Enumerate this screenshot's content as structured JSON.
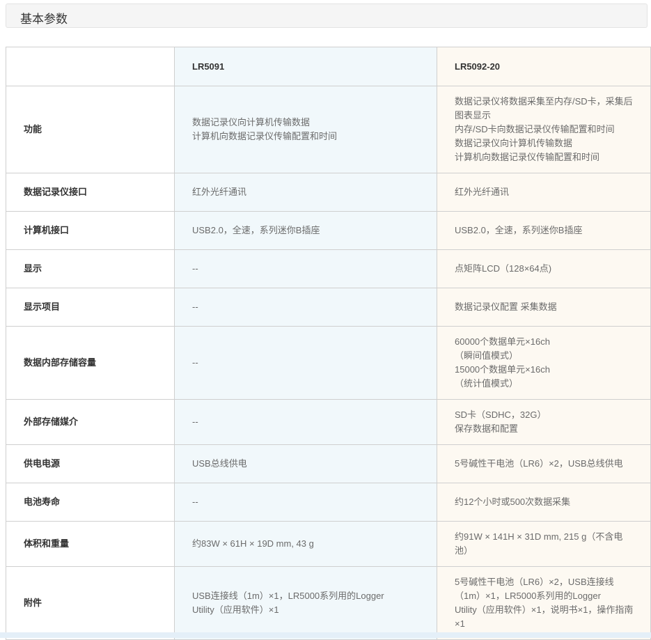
{
  "section": {
    "title": "基本参数"
  },
  "columns": {
    "model_a": "LR5091",
    "model_b": "LR5092-20"
  },
  "rows": [
    {
      "label": "功能",
      "a": [
        "数据记录仪向计算机传输数据",
        "计算机向数据记录仪传输配置和时间"
      ],
      "b": [
        "数据记录仪将数据采集至内存/SD卡，采集后",
        "图表显示",
        "内存/SD卡向数据记录仪传输配置和时间",
        "数据记录仪向计算机传输数据",
        "计算机向数据记录仪传输配置和时间"
      ]
    },
    {
      "label": "数据记录仪接口",
      "a": [
        "红外光纤通讯"
      ],
      "b": [
        "红外光纤通讯"
      ]
    },
    {
      "label": "计算机接口",
      "a": [
        "USB2.0，全速，系列迷你B插座"
      ],
      "b": [
        "USB2.0，全速，系列迷你B插座"
      ]
    },
    {
      "label": "显示",
      "a": [
        "--"
      ],
      "b": [
        "点矩阵LCD（128×64点)"
      ]
    },
    {
      "label": "显示项目",
      "a": [
        "--"
      ],
      "b": [
        "数据记录仪配置 采集数据"
      ]
    },
    {
      "label": "数据内部存储容量",
      "a": [
        "--"
      ],
      "b": [
        "60000个数据单元×16ch",
        "（瞬间值模式）",
        "15000个数据单元×16ch",
        "（统计值模式）"
      ]
    },
    {
      "label": "外部存储媒介",
      "a": [
        "--"
      ],
      "b": [
        "SD卡（SDHC，32G）",
        "保存数据和配置"
      ]
    },
    {
      "label": "供电电源",
      "a": [
        "USB总线供电"
      ],
      "b": [
        "5号碱性干电池（LR6）×2，USB总线供电"
      ]
    },
    {
      "label": "电池寿命",
      "a": [
        "--"
      ],
      "b": [
        "约12个小时或500次数据采集"
      ]
    },
    {
      "label": "体积和重量",
      "a": [
        "约83W × 61H × 19D mm, 43 g"
      ],
      "b": [
        "约91W × 141H × 31D mm, 215 g（不含电",
        "池）"
      ]
    },
    {
      "label": "附件",
      "a": [
        "USB连接线（1m）×1，LR5000系列用的Logger",
        "Utility（应用软件）×1"
      ],
      "b": [
        "5号碱性干电池（LR6）×2，USB连接线",
        "（1m）×1，LR5000系列用的Logger",
        "Utility（应用软件）×1，说明书×1，操作指南",
        "×1"
      ]
    }
  ],
  "colors": {
    "col_a_bg": "#f1f8fb",
    "col_b_bg": "#fdf9f2",
    "border": "#cfcfcf",
    "header_bg": "#f5f5f5"
  }
}
